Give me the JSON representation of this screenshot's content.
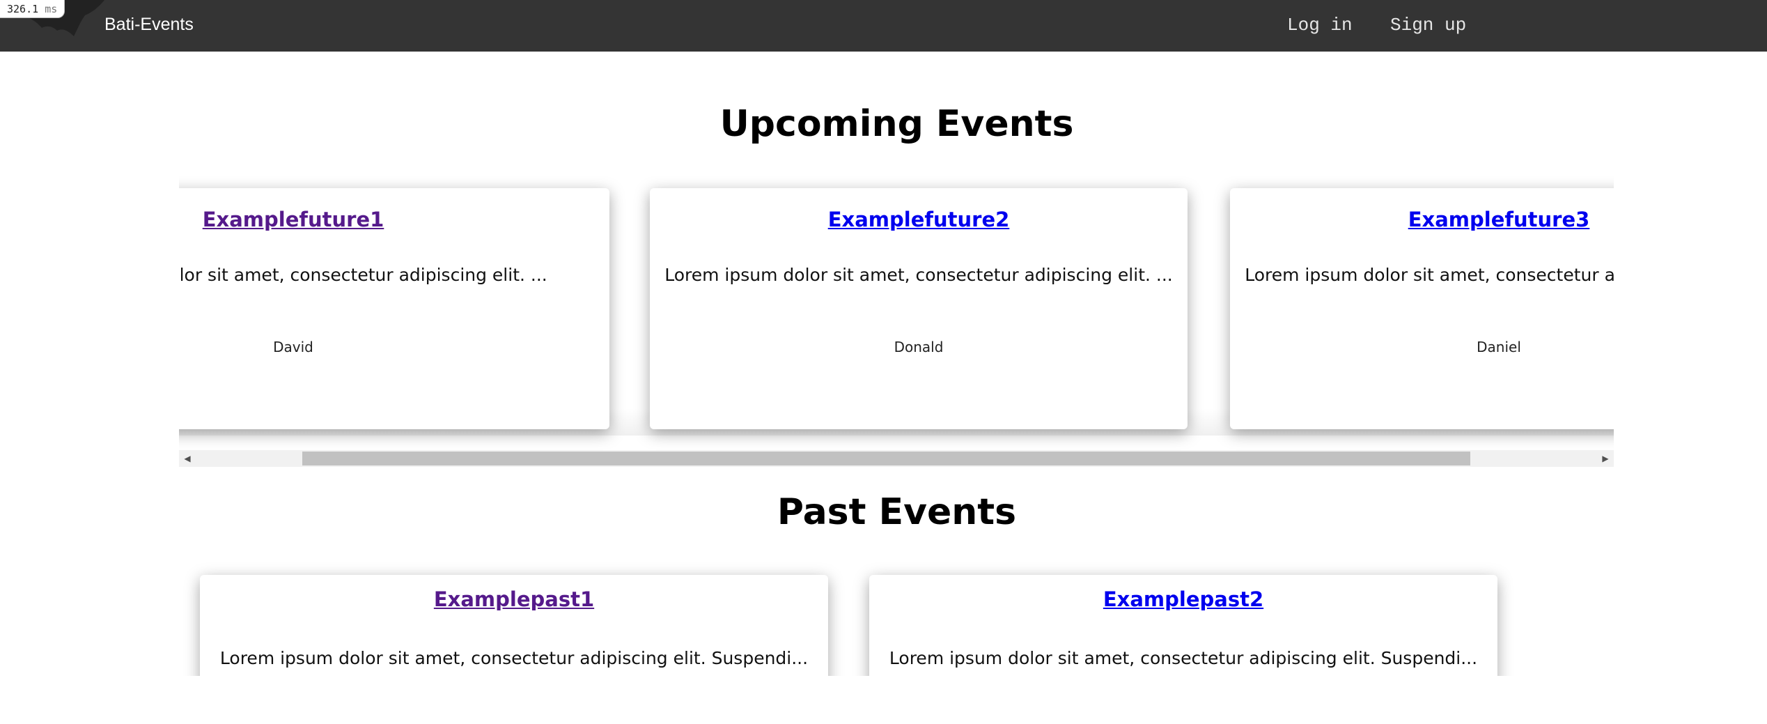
{
  "timing": {
    "value": "326.1",
    "unit": "ms"
  },
  "navbar": {
    "brand": "Bati-Events",
    "links": [
      {
        "label": "Log in"
      },
      {
        "label": "Sign up"
      }
    ]
  },
  "upcoming": {
    "title": "Upcoming Events",
    "events": [
      {
        "title": "Examplefuture1",
        "description": "Lorem ipsum dolor sit amet, consectetur adipiscing elit. ...",
        "author": "David",
        "visited": true
      },
      {
        "title": "Examplefuture2",
        "description": "Lorem ipsum dolor sit amet, consectetur adipiscing elit. ...",
        "author": "Donald",
        "visited": false
      },
      {
        "title": "Examplefuture3",
        "description": "Lorem ipsum dolor sit amet, consectetur adipiscing elit. ...",
        "author": "Daniel",
        "visited": false
      }
    ]
  },
  "past": {
    "title": "Past Events",
    "events": [
      {
        "title": "Examplepast1",
        "description": "Lorem ipsum dolor sit amet, consectetur adipiscing elit. Suspendi...",
        "visited": true
      },
      {
        "title": "Examplepast2",
        "description": "Lorem ipsum dolor sit amet, consectetur adipiscing elit. Suspendi...",
        "visited": false
      }
    ]
  },
  "colors": {
    "navbar_bg": "#343434",
    "link_visited": "#551a8b",
    "link_unvisited": "#0000ee",
    "scrollbar_thumb": "#c1c1c1"
  },
  "icons": [
    "bat-logo-icon",
    "scroll-left-arrow-icon",
    "scroll-right-arrow-icon"
  ]
}
